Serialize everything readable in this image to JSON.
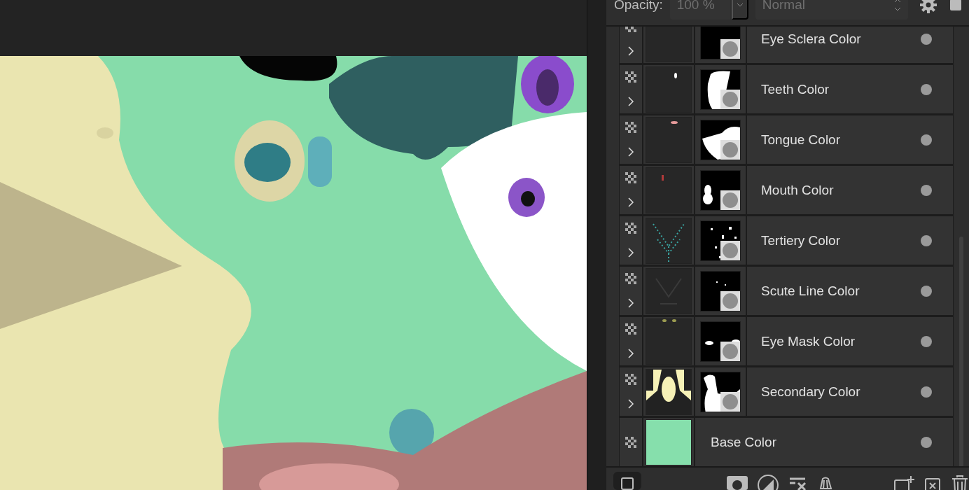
{
  "toolbar": {
    "opacity_label": "Opacity:",
    "opacity_value": "100 %",
    "blend_mode": "Normal"
  },
  "layers": [
    {
      "name": "Eye Sclera Color",
      "kind": "masked",
      "visible": true
    },
    {
      "name": "Teeth Color",
      "kind": "masked",
      "visible": true
    },
    {
      "name": "Tongue Color",
      "kind": "masked",
      "visible": true
    },
    {
      "name": "Mouth Color",
      "kind": "masked",
      "visible": true
    },
    {
      "name": "Tertiery Color",
      "kind": "masked",
      "visible": true
    },
    {
      "name": "Scute Line Color",
      "kind": "masked",
      "visible": true
    },
    {
      "name": "Eye Mask Color",
      "kind": "masked",
      "visible": true
    },
    {
      "name": "Secondary Color",
      "kind": "masked",
      "visible": true
    },
    {
      "name": "Base Color",
      "kind": "fill",
      "color": "#86dfac",
      "visible": true
    }
  ]
}
